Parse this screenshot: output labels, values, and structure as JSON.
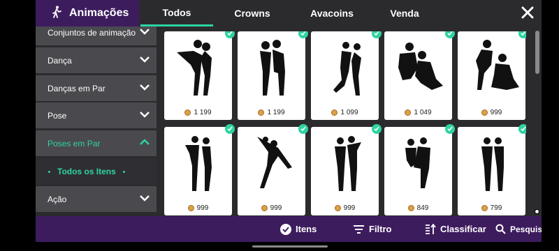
{
  "header": {
    "title": "Animações",
    "tabs": [
      "Todos",
      "Crowns",
      "Avacoins",
      "Venda"
    ],
    "active_tab": "Todos"
  },
  "sidebar": {
    "items": [
      {
        "label": "Conjuntos de animação",
        "expanded": false
      },
      {
        "label": "Dança",
        "expanded": false
      },
      {
        "label": "Danças em Par",
        "expanded": false
      },
      {
        "label": "Pose",
        "expanded": false
      },
      {
        "label": "Poses em Par",
        "expanded": true
      },
      {
        "label": "Ação",
        "expanded": false
      }
    ],
    "subitem": "Todos os Itens"
  },
  "grid": {
    "cards": [
      {
        "price": "1 199",
        "owned": true
      },
      {
        "price": "1 199",
        "owned": true
      },
      {
        "price": "1 099",
        "owned": true
      },
      {
        "price": "1 049",
        "owned": true
      },
      {
        "price": "999",
        "owned": true
      },
      {
        "price": "999",
        "owned": true
      },
      {
        "price": "999",
        "owned": true
      },
      {
        "price": "999",
        "owned": true
      },
      {
        "price": "849",
        "owned": true
      },
      {
        "price": "799",
        "owned": true
      }
    ]
  },
  "bottombar": {
    "items_label": "Itens",
    "filter_label": "Filtro",
    "sort_label": "Classificar",
    "search_label": "Pesquisa"
  },
  "colors": {
    "accent": "#2ed3a2",
    "purple": "#3d1c5e",
    "panel": "#2b2b2e",
    "sidebar_item": "#4a4a4e"
  },
  "icons": {
    "title": "dance-person-icon",
    "close": "close-icon",
    "chevron": "chevron-icon",
    "owned": "check-icon",
    "currency": "coin-icon"
  }
}
